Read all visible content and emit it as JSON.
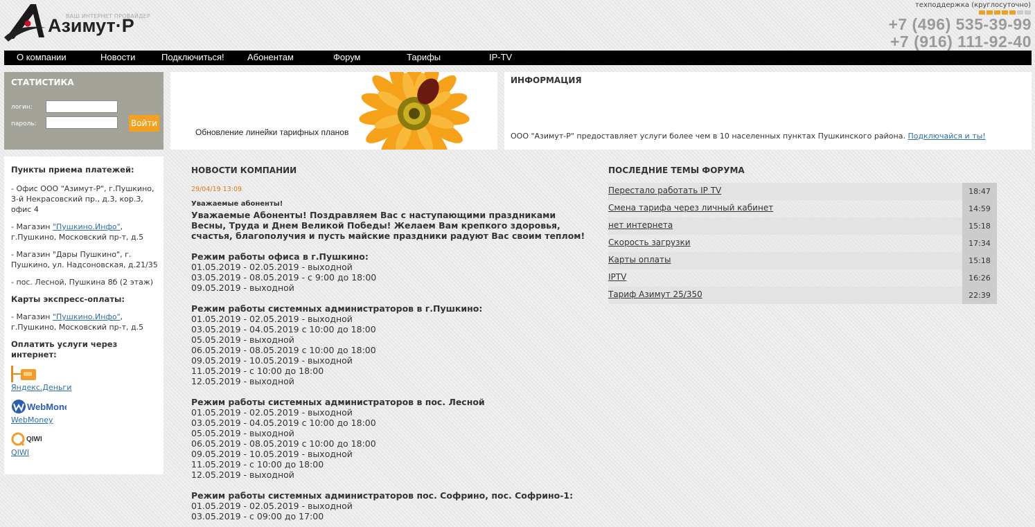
{
  "header": {
    "brand": "Азимут·Р",
    "slogan": "ВАШ ИНТЕРНЕТ ПРОВАЙДЕР",
    "support": "техподдержка (круглосуточно)",
    "phone1": "+7 (496) 535-39-99",
    "phone2": "+7 (916) 111-92-40",
    "accent": "#f0a01e"
  },
  "nav": [
    {
      "label": "О компании"
    },
    {
      "label": "Новости"
    },
    {
      "label": "Подключиться!"
    },
    {
      "label": "Абонентам"
    },
    {
      "label": "Форум"
    },
    {
      "label": "Тарифы"
    },
    {
      "label": "IP-TV"
    }
  ],
  "stats": {
    "title": "СТАТИСТИКА",
    "login_label": "логин:",
    "password_label": "пароль:",
    "login_value": "",
    "password_value": "",
    "submit": "Войти"
  },
  "banner": {
    "text": "Обновление линейки тарифных планов"
  },
  "info": {
    "title": "ИНФОРМАЦИЯ",
    "text": "ООО \"Азимут-Р\" предоставляет услуги более чем в 10 населенных пунктах Пушкинского района.",
    "link": "Подключайся и ты!"
  },
  "left": {
    "payments_title": "Пункты приема платежей:",
    "office": "- Офис ООО \"Азимут-Р\", г.Пушкино, 3-й Некрасовский пр., д.3, кор.3, офис 4",
    "shop1_prefix": "- Магазин ",
    "shop1_link": "\"Пушкино.Инфо\"",
    "shop1_suffix": ", г.Пушкино, Московский пр-т, д.5",
    "shop2": "- Магазин \"Дары Пушкино\", г. Пушкино, ул. Надсоновская, д.21/35",
    "shop3": "- пос. Лесной, Пушкина 8б (2 этаж)",
    "cards_title": "Карты экспресс-оплаты:",
    "card_shop_prefix": "- Магазин ",
    "card_shop_link": "\"Пушкино.Инфо\"",
    "card_shop_suffix": ", г.Пушкино, Московский пр-т, д.5",
    "online_title": "Оплатить услуги через интернет:",
    "methods": [
      {
        "label": "Яндекс.Деньги",
        "icon": "yandex-money-icon"
      },
      {
        "label": "WebMoney",
        "icon": "webmoney-icon"
      },
      {
        "label": "QIWI",
        "icon": "qiwi-icon"
      }
    ]
  },
  "news": {
    "title": "НОВОСТИ КОМПАНИИ",
    "date": "29/04/19 13:09",
    "subtitle": "Уважаемые абоненты!",
    "greeting": "Уважаемые Абоненты! Поздравляем Вас с наступающими праздниками Весны, Труда и Днем Великой Победы! Желаем Вам крепкого здоровья, счастья, благополучия и пусть майские праздники радуют Вас своим теплом!",
    "blocks": [
      {
        "heading": "Режим работы офиса в г.Пушкино:",
        "lines": [
          "01.05.2019 - 02.05.2019 - выходной",
          "03.05.2019 - 08.05.2019 - с 9:00 до 18:00",
          "09.05.2019 - выходной"
        ]
      },
      {
        "heading": "Режим работы системных администраторов в г.Пушкино:",
        "lines": [
          "01.05.2019 - 02.05.2019 - выходной",
          "03.05.2019 - 04.05.2019 с 10:00 до 18:00",
          "05.05.2019 - выходной",
          "06.05.2019 - 08.05.2019 с 10:00 до 18:00",
          "09.05.2019 - 10.05.2019 - выходной",
          "11.05.2019 - с 10:00 до 18:00",
          "12.05.2019 - выходной"
        ]
      },
      {
        "heading": "Режим работы системных администраторов в пос. Лесной",
        "lines": [
          "01.05.2019 - 02.05.2019 - выходной",
          "03.05.2019 - 04.05.2019 с 10:00 до 18:00",
          "05.05.2019 - выходной",
          "06.05.2019 - 08.05.2019 с 10:00 до 18:00",
          "09.05.2019 - 10.05.2019 - выходной",
          "11.05.2019 - с 10:00 до 18:00",
          "12.05.2019 - выходной"
        ]
      },
      {
        "heading": "Режим работы системных администраторов пос. Софрино, пос. Софрино-1:",
        "lines": [
          "01.05.2019 - 02.05.2019 - выходной",
          "03.05.2019 - с 09:00 до 17:00"
        ]
      }
    ]
  },
  "forum": {
    "title": "ПОСЛЕДНИЕ ТЕМЫ ФОРУМА",
    "topics": [
      {
        "title": "Перестало работать IP TV",
        "time": "18:47"
      },
      {
        "title": "Смена тарифа через личный кабинет",
        "time": "14:59"
      },
      {
        "title": "нет интернета",
        "time": "15:18"
      },
      {
        "title": "Скорость загрузки",
        "time": "17:34"
      },
      {
        "title": "Карты оплаты",
        "time": "15:18"
      },
      {
        "title": "IPTV",
        "time": "16:26"
      },
      {
        "title": "Тариф Азимут 25/350",
        "time": "22:39"
      }
    ]
  }
}
